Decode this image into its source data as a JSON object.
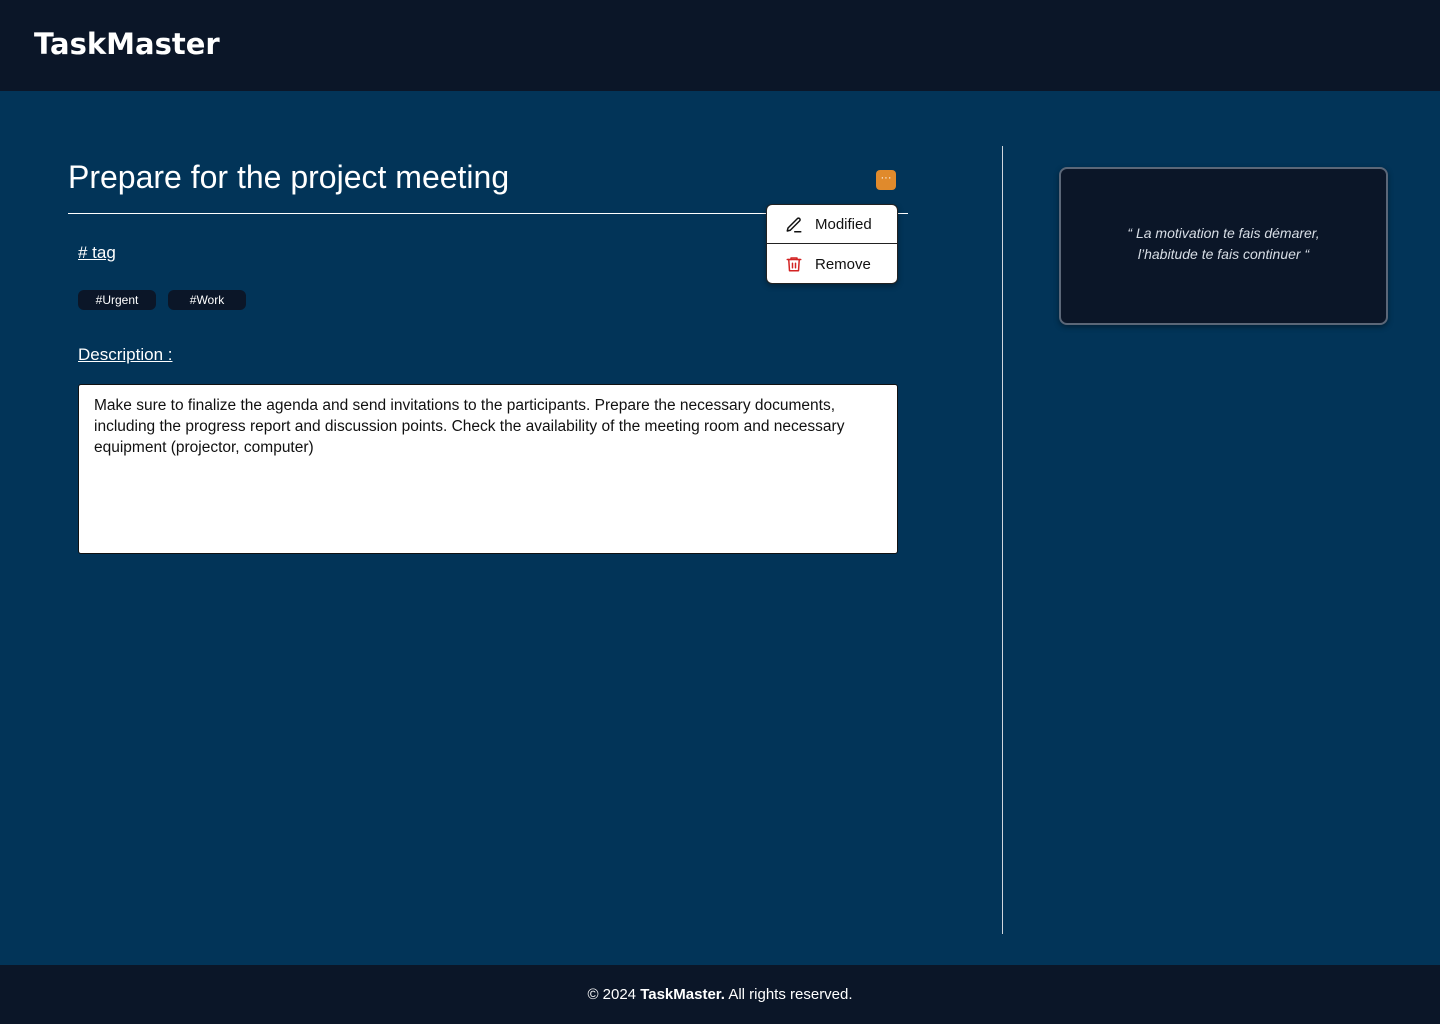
{
  "app": {
    "logo": "TaskMaster"
  },
  "task": {
    "title": "Prepare for the project meeting",
    "tag_heading": "# tag",
    "tags": [
      "#Urgent",
      "#Work"
    ],
    "description_heading": "Description :",
    "description": "Make sure to finalize the agenda and send invitations to the participants. Prepare the necessary documents, including the progress report and discussion points. Check the availability of the meeting room and necessary equipment (projector, computer)"
  },
  "more_button": {
    "label": "···",
    "color": "#e08a2c"
  },
  "menu": {
    "items": [
      {
        "label": "Modified",
        "icon": "pencil-icon"
      },
      {
        "label": "Remove",
        "icon": "trash-icon",
        "icon_color": "#d32222"
      }
    ]
  },
  "quote": {
    "line1": "“ La motivation te fais démarer,",
    "line2": "l’habitude te fais continuer  “"
  },
  "footer": {
    "prefix": "© 2024 ",
    "brand": "TaskMaster.",
    "suffix": " All rights reserved."
  },
  "colors": {
    "header_bg": "#0b1628",
    "main_bg": "#023458",
    "accent": "#e08a2c"
  }
}
